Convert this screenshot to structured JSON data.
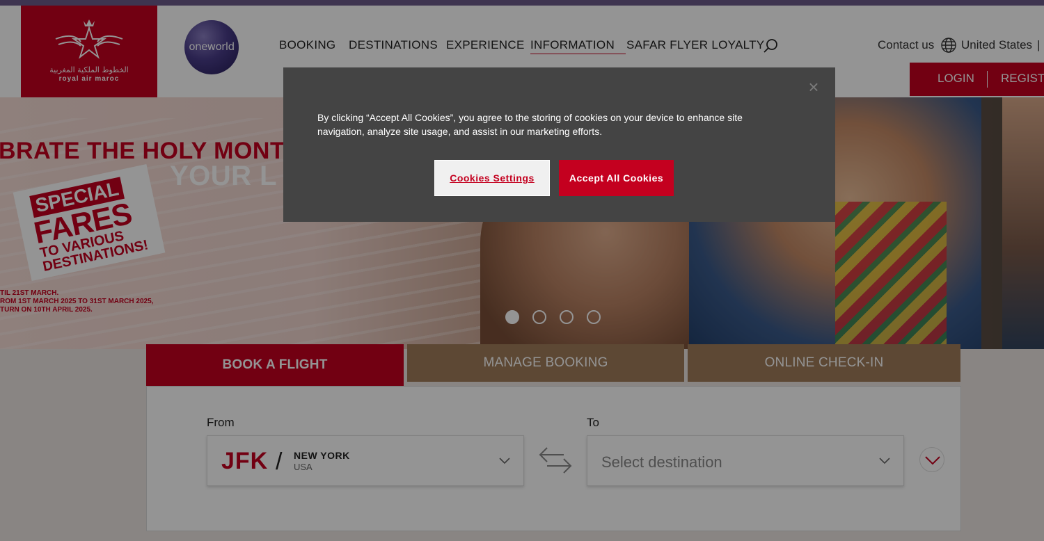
{
  "header": {
    "logo": {
      "arabic_text": "الخطوط الملكية المغربية",
      "english_text": "royal air maroc"
    },
    "oneworld_text": "oneworld",
    "nav": [
      {
        "label": "BOOKING"
      },
      {
        "label": "DESTINATIONS"
      },
      {
        "label": "EXPERIENCE"
      },
      {
        "label": "INFORMATION"
      },
      {
        "label": "SAFAR FLYER LOYALTY"
      }
    ],
    "contact_label": "Contact us",
    "country_label": "United States",
    "country_separator": "|",
    "login_label": "LOGIN",
    "register_label": "REGISTI"
  },
  "hero": {
    "headline_line1": "BRATE THE HOLY MONTH WITH",
    "headline_line2": "YOUR L",
    "promo_line1": "SPECIAL",
    "promo_line2": "FARES",
    "promo_line3": "TO VARIOUS",
    "promo_line4": "DESTINATIONS!",
    "fine_print": [
      "TIL 21ST MARCH.",
      "ROM 1ST MARCH 2025 TO 31ST MARCH 2025,",
      "TURN ON 10TH APRIL 2025."
    ],
    "carousel": {
      "count": 4,
      "active_index": 0
    }
  },
  "booking": {
    "tabs": [
      {
        "label": "BOOK A FLIGHT"
      },
      {
        "label": "MANAGE BOOKING"
      },
      {
        "label": "ONLINE CHECK-IN"
      }
    ],
    "from_label": "From",
    "to_label": "To",
    "from_field": {
      "code": "JFK",
      "separator": "/",
      "city": "NEW YORK",
      "country": "USA"
    },
    "to_field": {
      "placeholder": "Select destination"
    }
  },
  "cookie_banner": {
    "text": "By clicking “Accept All Cookies”, you agree to the storing of cookies on your device to enhance site navigation, analyze site usage, and assist in our marketing efforts.",
    "settings_label": "Cookies Settings",
    "accept_label": "Accept All Cookies",
    "close_glyph": "×"
  },
  "colors": {
    "brand_red": "#c4001f",
    "tab_brown": "#a07c5a",
    "banner_bg": "#444444"
  }
}
